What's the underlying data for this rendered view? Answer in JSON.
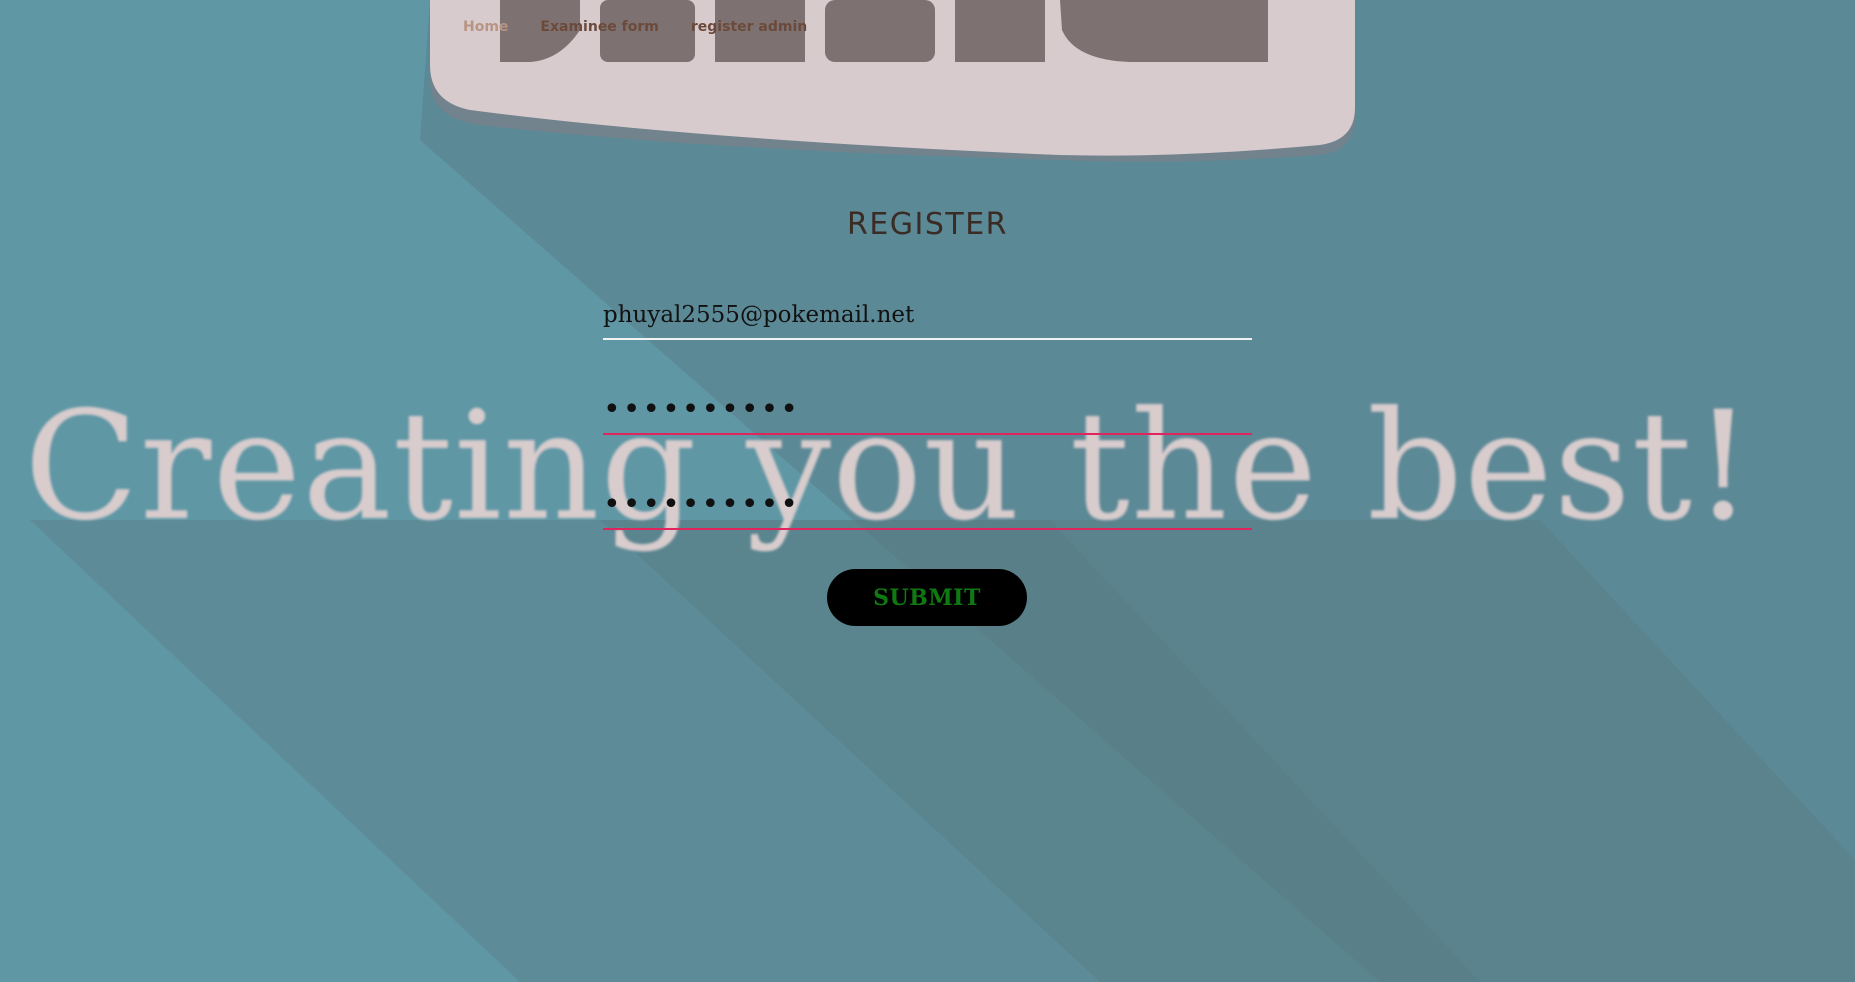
{
  "nav": {
    "items": [
      {
        "label": "Home",
        "active": true
      },
      {
        "label": "Examinee form",
        "active": false
      },
      {
        "label": "register admin",
        "active": false
      }
    ]
  },
  "background": {
    "slogan": "Creating you the best!",
    "logo_text": "Genesis"
  },
  "form": {
    "title": "REGISTER",
    "email_value": "phuyal2555@pokemail.net",
    "password_value": "••••••••••",
    "confirm_password_value": "••••••••••",
    "submit_label": "SUBMIT"
  },
  "colors": {
    "background": "#5f97a5",
    "submit_text": "#0f7a12",
    "password_underline": "#e0245e",
    "email_underline": "#f2f2f2"
  }
}
